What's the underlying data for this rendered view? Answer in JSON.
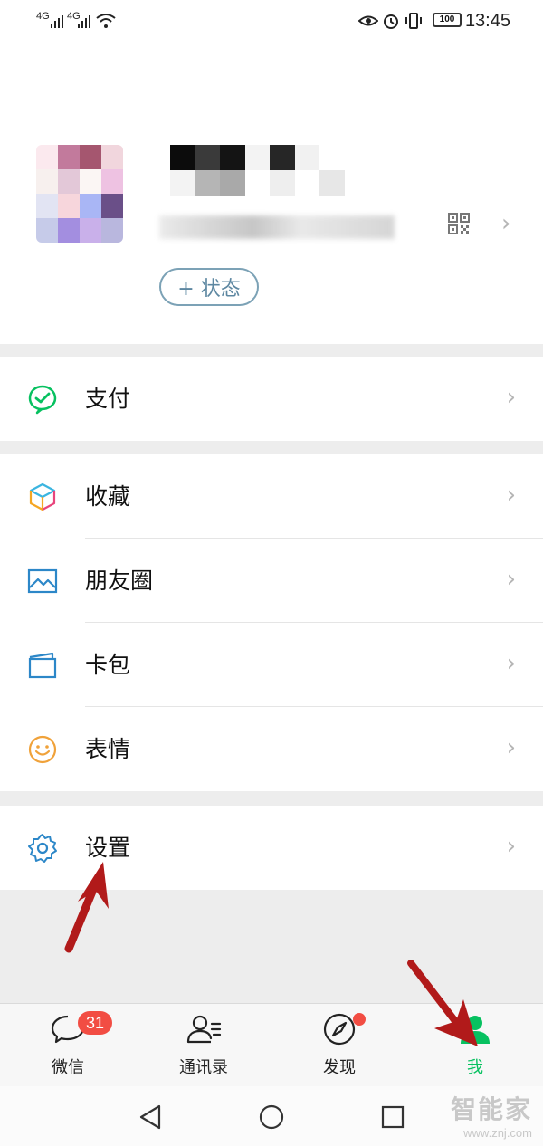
{
  "status_bar": {
    "signal_1": "4G",
    "signal_2": "4G",
    "battery": "100",
    "time": "13:45",
    "icons": [
      "wifi-icon",
      "eye-icon",
      "alarm-icon",
      "vibrate-icon"
    ]
  },
  "profile": {
    "status_button_label": "+ 状态",
    "icons": [
      "qr-code-icon",
      "chevron-right-icon"
    ]
  },
  "menu": {
    "pay": "支付",
    "favorites": "收藏",
    "moments": "朋友圈",
    "cards": "卡包",
    "stickers": "表情",
    "settings": "设置"
  },
  "tabs": [
    {
      "label": "微信",
      "icon": "chat-icon",
      "badge": "31"
    },
    {
      "label": "通讯录",
      "icon": "contacts-icon"
    },
    {
      "label": "发现",
      "icon": "compass-icon"
    },
    {
      "label": "我",
      "icon": "person-icon"
    }
  ],
  "watermark": {
    "brand": "智能家",
    "url": "www.znj.com"
  },
  "colors": {
    "accent_green": "#07c160",
    "badge_red": "#f24d43",
    "annotation_red": "#b11a1a"
  }
}
